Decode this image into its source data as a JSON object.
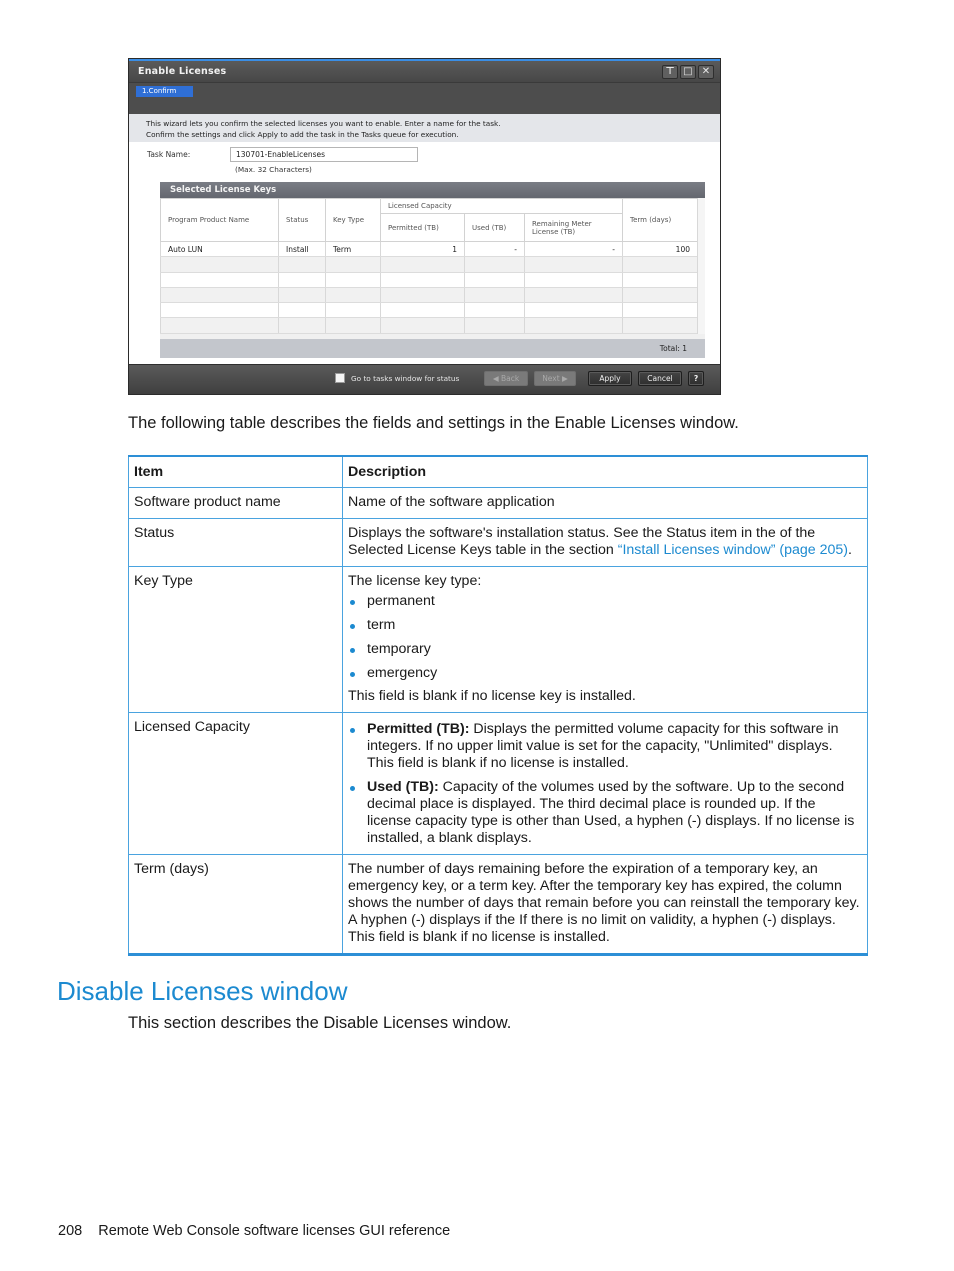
{
  "dialog": {
    "title": "Enable Licenses",
    "window_buttons": [
      "pin-icon",
      "maximize-icon",
      "close-icon"
    ],
    "step": "1.Confirm",
    "info_lines": [
      "This wizard lets you confirm the selected licenses you want to enable. Enter a name for the task.",
      "Confirm the settings and click Apply to add the task in the Tasks queue for execution."
    ],
    "task_name_label": "Task Name:",
    "task_name_value": "130701-EnableLicenses",
    "task_name_hint": "(Max. 32 Characters)",
    "selected_license_keys": {
      "title": "Selected License Keys",
      "group_header": "Licensed Capacity",
      "columns": [
        "Program Product Name",
        "Status",
        "Key Type",
        "Permitted (TB)",
        "Used (TB)",
        "Remaining Meter License (TB)",
        "Term (days)"
      ],
      "rows": [
        [
          "Auto LUN",
          "Install",
          "Term",
          "1",
          "-",
          "-",
          "100"
        ]
      ],
      "total": "Total:  1"
    },
    "footer": {
      "goto_label": "Go to tasks window for status",
      "back": "◀ Back",
      "next": "Next ▶",
      "apply": "Apply",
      "cancel": "Cancel",
      "help": "?"
    }
  },
  "intro": "The following table describes the fields and settings in the Enable Licenses window.",
  "table": {
    "headers": [
      "Item",
      "Description"
    ],
    "rows": {
      "software": {
        "item": "Software product name",
        "desc": "Name of the software application"
      },
      "status": {
        "item": "Status",
        "desc": "Displays the software's installation status. See the Status item in the of the Selected License Keys table in the section ",
        "link": "“Install Licenses window” (page 205)",
        "desc_end": "."
      },
      "keytype": {
        "item": "Key Type",
        "desc": "The license key type:",
        "bullets": [
          "permanent",
          "term",
          "temporary",
          "emergency"
        ],
        "note": "This field is blank if no license key is installed."
      },
      "capacity": {
        "item": "Licensed Capacity",
        "bullets": [
          {
            "term": "Permitted (TB):",
            "text": " Displays the permitted volume capacity for this software in integers. If no upper limit value is set for the capacity, \"Unlimited\" displays. This field is blank if no license is installed."
          },
          {
            "term": "Used (TB):",
            "text": " Capacity of the volumes used by the software. Up to the second decimal place is displayed. The third decimal place is rounded up. If the license capacity type is other than Used, a hyphen (-) displays. If no license is installed, a blank displays."
          }
        ]
      },
      "term": {
        "item": "Term (days)",
        "desc": "The number of days remaining before the expiration of a temporary key, an emergency key, or a term key. After the temporary key has expired, the column shows the number of days that remain before you can reinstall the temporary key. A hyphen (-) displays if the If there is no limit on validity, a hyphen (-) displays. This field is blank if no license is installed."
      }
    }
  },
  "section": {
    "title": "Disable Licenses window",
    "desc": "This section describes the Disable Licenses window."
  },
  "footer": {
    "page_number": "208",
    "text": "Remote Web Console software licenses GUI reference"
  },
  "colors": {
    "accent": "#1c8ad0",
    "table_border": "#4aa3df",
    "dialog_title_bg": "#4d4d4d",
    "step_active": "#2f6fd6"
  }
}
